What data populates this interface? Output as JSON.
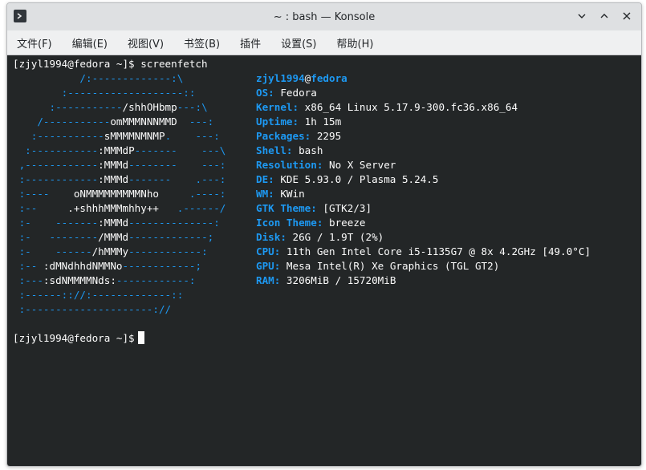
{
  "window": {
    "title": "~ : bash — Konsole"
  },
  "menu": [
    "文件(F)",
    "编辑(E)",
    "视图(V)",
    "书签(B)",
    "插件",
    "设置(S)",
    "帮助(H)"
  ],
  "terminal": {
    "prompt": "[zjyl1994@fedora ~]$ screenfetch",
    "prompt2": "[zjyl1994@fedora ~]$",
    "logo": [
      [
        "           /:-------------:\\",
        ""
      ],
      [
        "        :-------------------::",
        ""
      ],
      [
        "      :-----------",
        "/shhOHbmp",
        "---:\\"
      ],
      [
        "    /-----------",
        "omMMMNNNMMD",
        "  ---:"
      ],
      [
        "   :-----------",
        "sMMMMNMNMP",
        ".    ---:"
      ],
      [
        "  :-----------",
        ":MMMdP",
        "-------    ---\\"
      ],
      [
        " ,------------",
        ":MMMd",
        "--------    ---:"
      ],
      [
        " :------------",
        ":MMMd",
        "-------    .---:"
      ],
      [
        " :----    ",
        "oNMMMMMMMMMNho",
        "     .----:"
      ],
      [
        " :--     ",
        ".+shhhMMMmhhy++",
        "   .------/"
      ],
      [
        " :-    -------",
        ":MMMd",
        "--------------:"
      ],
      [
        " :-   --------",
        "/MMMd",
        "-------------;"
      ],
      [
        " :-    ------",
        "/hMMMy",
        "------------:"
      ],
      [
        " :-- ",
        ":dMNdhhdNMMNo",
        "------------;"
      ],
      [
        " :---",
        ":sdNMMMMNds:",
        "------------:"
      ],
      [
        " :------:://:-------------::",
        ""
      ],
      [
        " :---------------------://",
        ""
      ]
    ],
    "user": "zjyl1994",
    "at": "@",
    "host": "fedora",
    "info": [
      {
        "key": "OS:",
        "value": " Fedora"
      },
      {
        "key": "Kernel:",
        "value": " x86_64 Linux 5.17.9-300.fc36.x86_64"
      },
      {
        "key": "Uptime:",
        "value": " 1h 15m"
      },
      {
        "key": "Packages:",
        "value": " 2295"
      },
      {
        "key": "Shell:",
        "value": " bash"
      },
      {
        "key": "Resolution:",
        "value": " No X Server"
      },
      {
        "key": "DE:",
        "value": " KDE 5.93.0 / Plasma 5.24.5"
      },
      {
        "key": "WM:",
        "value": " KWin"
      },
      {
        "key": "GTK Theme:",
        "value": " [GTK2/3]"
      },
      {
        "key": "Icon Theme:",
        "value": " breeze"
      },
      {
        "key": "Disk:",
        "value": " 26G / 1.9T (2%)"
      },
      {
        "key": "CPU:",
        "value": " 11th Gen Intel Core i5-1135G7 @ 8x 4.2GHz [49.0°C]"
      },
      {
        "key": "GPU:",
        "value": " Mesa Intel(R) Xe Graphics (TGL GT2)"
      },
      {
        "key": "RAM:",
        "value": " 3206MiB / 15720MiB"
      }
    ]
  },
  "colors": {
    "accent": "#1d99f3",
    "background": "#232627",
    "foreground": "#fcfcfc"
  },
  "icons": [
    "konsole-icon",
    "chevron-down-icon",
    "minimize-icon",
    "close-icon"
  ]
}
